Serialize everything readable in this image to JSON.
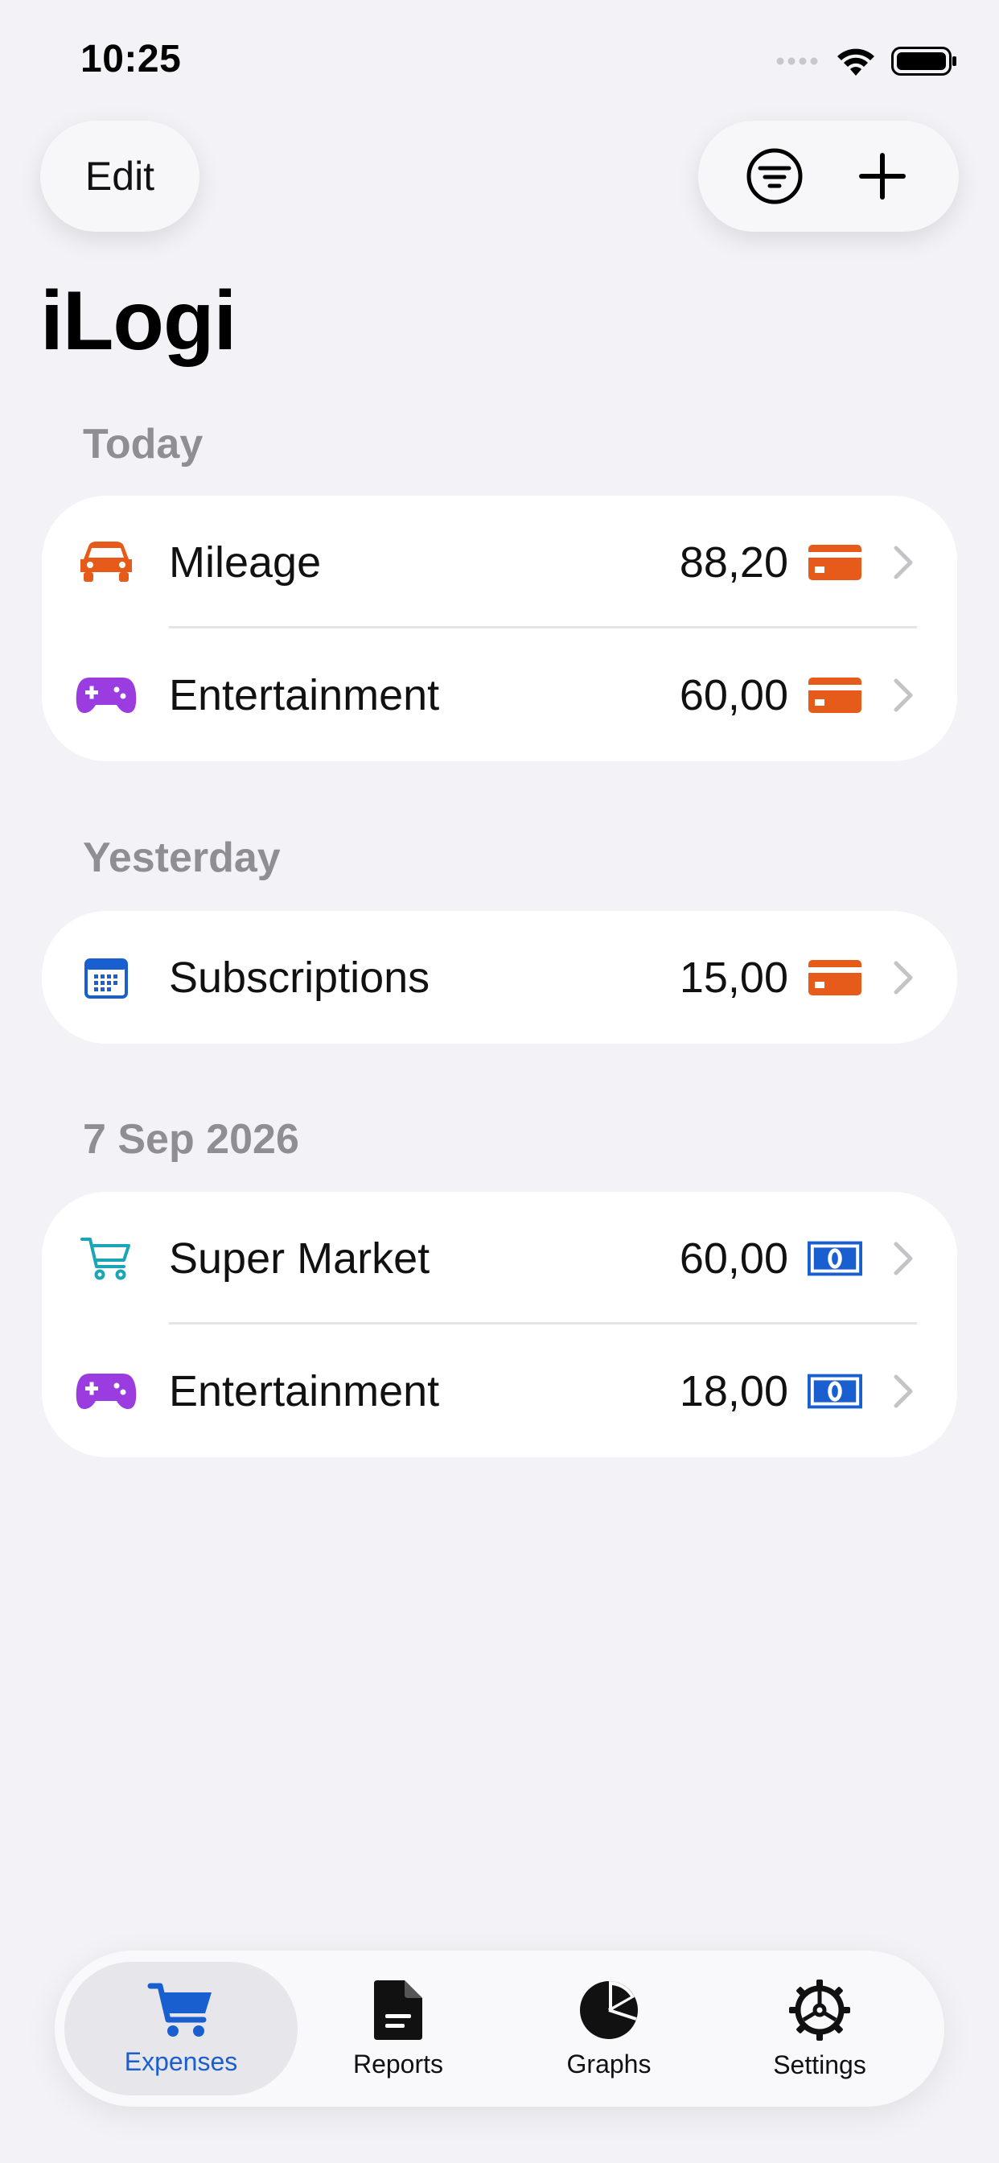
{
  "status_bar": {
    "time": "10:25"
  },
  "header": {
    "edit_label": "Edit",
    "title": "iLogi"
  },
  "colors": {
    "orange": "#e65a1a",
    "purple": "#9b3ce0",
    "blue": "#1a5fd0",
    "teal": "#1aa6b7",
    "gray": "#8e8e93"
  },
  "sections": [
    {
      "title": "Today",
      "items": [
        {
          "label": "Mileage",
          "amount": "88,20",
          "icon": "car-icon",
          "payment": "card-icon"
        },
        {
          "label": "Entertainment",
          "amount": "60,00",
          "icon": "gamecontroller-icon",
          "payment": "card-icon"
        }
      ]
    },
    {
      "title": "Yesterday",
      "items": [
        {
          "label": "Subscriptions",
          "amount": "15,00",
          "icon": "calendar-icon",
          "payment": "card-icon"
        }
      ]
    },
    {
      "title": "7 Sep 2026",
      "items": [
        {
          "label": "Super Market",
          "amount": "60,00",
          "icon": "cart-icon",
          "payment": "cash-icon"
        },
        {
          "label": "Entertainment",
          "amount": "18,00",
          "icon": "gamecontroller-icon",
          "payment": "cash-icon"
        }
      ]
    }
  ],
  "tabbar": {
    "tabs": [
      {
        "label": "Expenses",
        "icon": "cart-icon",
        "active": true
      },
      {
        "label": "Reports",
        "icon": "document-icon",
        "active": false
      },
      {
        "label": "Graphs",
        "icon": "piechart-icon",
        "active": false
      },
      {
        "label": "Settings",
        "icon": "gear-icon",
        "active": false
      }
    ]
  }
}
